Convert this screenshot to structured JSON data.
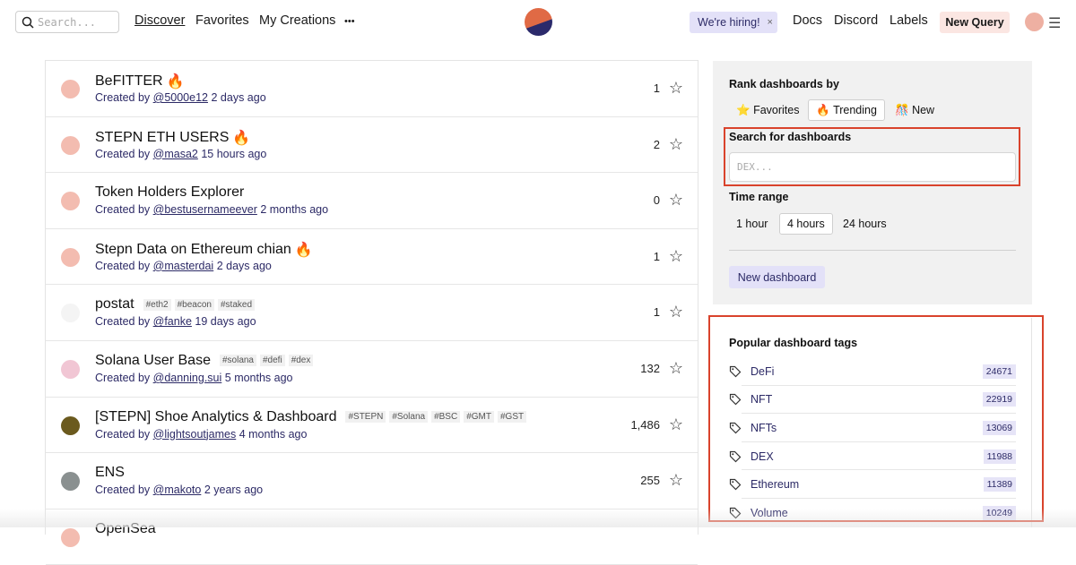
{
  "header": {
    "search_placeholder": "Search...",
    "nav": [
      "Discover",
      "Favorites",
      "My Creations"
    ],
    "more": "•••",
    "hiring": "We're hiring!",
    "hiring_close": "×",
    "links": [
      "Docs",
      "Discord",
      "Labels"
    ],
    "new_query": "New Query"
  },
  "dashboards": [
    {
      "title": "BeFITTER",
      "fire": true,
      "tags": [],
      "author": "@5000e12",
      "age": "2 days ago",
      "stars": "1",
      "avatar": "#f3bcb0"
    },
    {
      "title": "STEPN ETH USERS",
      "fire": true,
      "tags": [],
      "author": "@masa2",
      "age": "15 hours ago",
      "stars": "2",
      "avatar": "#f3bcb0"
    },
    {
      "title": "Token Holders Explorer",
      "fire": false,
      "tags": [],
      "author": "@bestusernameever",
      "age": "2 months ago",
      "stars": "0",
      "avatar": "#f3bcb0"
    },
    {
      "title": "Stepn Data on Ethereum chian",
      "fire": true,
      "tags": [],
      "author": "@masterdai",
      "age": "2 days ago",
      "stars": "1",
      "avatar": "#f3bcb0"
    },
    {
      "title": "postat",
      "fire": false,
      "tags": [
        "#eth2",
        "#beacon",
        "#staked"
      ],
      "author": "@fanke",
      "age": "19 days ago",
      "stars": "1",
      "avatar": "#f4f4f4"
    },
    {
      "title": "Solana User Base",
      "fire": false,
      "tags": [
        "#solana",
        "#defi",
        "#dex"
      ],
      "author": "@danning.sui",
      "age": "5 months ago",
      "stars": "132",
      "avatar": "#f1c6d4"
    },
    {
      "title": "[STEPN] Shoe Analytics & Dashboard",
      "fire": false,
      "tags": [
        "#STEPN",
        "#Solana",
        "#BSC",
        "#GMT",
        "#GST"
      ],
      "author": "@lightsoutjames",
      "age": "4 months ago",
      "stars": "1,486",
      "avatar": "#6b5a1e"
    },
    {
      "title": "ENS",
      "fire": false,
      "tags": [],
      "author": "@makoto",
      "age": "2 years ago",
      "stars": "255",
      "avatar": "#8a9090"
    },
    {
      "title": "OpenSea",
      "fire": false,
      "tags": [],
      "author": "",
      "age": "",
      "stars": "",
      "avatar": "#f3bcb0"
    }
  ],
  "created_by": "Created by",
  "sidebar": {
    "rank_label": "Rank dashboards by",
    "rank_options": [
      "Favorites",
      "Trending",
      "New"
    ],
    "rank_icons": [
      "⭐",
      "🔥",
      "🎊"
    ],
    "search_label": "Search for dashboards",
    "search_placeholder": "DEX...",
    "time_label": "Time range",
    "time_options": [
      "1 hour",
      "4 hours",
      "24 hours"
    ],
    "new_dashboard": "New dashboard",
    "tags_label": "Popular dashboard tags",
    "tags": [
      {
        "name": "DeFi",
        "count": "24671"
      },
      {
        "name": "NFT",
        "count": "22919"
      },
      {
        "name": "NFTs",
        "count": "13069"
      },
      {
        "name": "DEX",
        "count": "11988"
      },
      {
        "name": "Ethereum",
        "count": "11389"
      },
      {
        "name": "Volume",
        "count": "10249"
      }
    ]
  },
  "colors": {
    "accent": "#2c2a66",
    "highlight": "#d9432c",
    "hiring_bg": "#e3e1f8",
    "new_query_bg": "#fbe6e2"
  }
}
